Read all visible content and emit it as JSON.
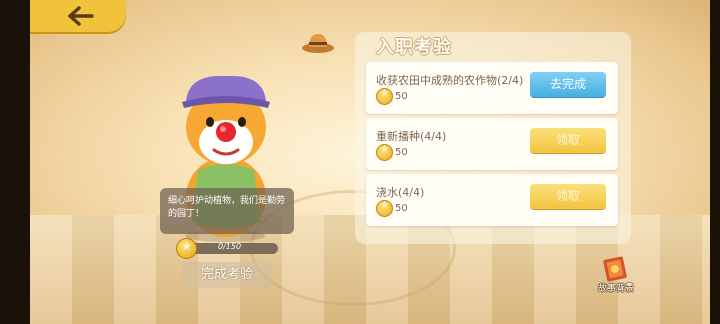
{
  "header": {
    "title": "入职考验"
  },
  "tasks": [
    {
      "name": "收获农田中成熟的农作物(2/4)",
      "reward": "50",
      "button": "去完成",
      "button_style": "blue"
    },
    {
      "name": "重新播种(4/4)",
      "reward": "50",
      "button": "领取",
      "button_style": "gold"
    },
    {
      "name": "浇水(4/4)",
      "reward": "50",
      "button": "领取",
      "button_style": "gold"
    }
  ],
  "character": {
    "tip": "细心呵护动植物，我们是勤劳的园丁！"
  },
  "progress": {
    "label": "0/150",
    "current": 0,
    "max": 150
  },
  "actions": {
    "complete_label": "完成考验",
    "story_label": "故事背景"
  },
  "colors": {
    "accent_gold": "#f0c33b",
    "button_blue": "#47aee0",
    "button_gold": "#f3c340"
  },
  "icons": [
    "back-arrow-icon",
    "cowboy-hat-icon",
    "star-coin-icon",
    "story-book-icon"
  ]
}
